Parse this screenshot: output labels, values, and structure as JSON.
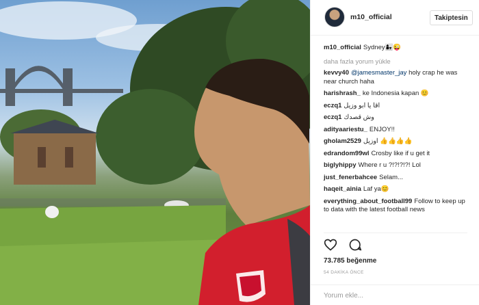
{
  "post": {
    "username": "m10_official",
    "follow_label": "Takiptesin"
  },
  "caption": {
    "user": "m10_official",
    "text": "Sydney👩‍👧😜"
  },
  "load_more_label": "daha fazla yorum yükle",
  "comments": [
    {
      "user": "kevvy40",
      "mention": "@jamesmaster_jay",
      "text": " holy crap he was near church haha"
    },
    {
      "user": "harishrash_",
      "mention": "",
      "text": "ke Indonesia kapan 😊"
    },
    {
      "user": "eczq1",
      "mention": "",
      "text": "اقا یا ابو وزیل"
    },
    {
      "user": "eczq1",
      "mention": "",
      "text": "وش قصدك"
    },
    {
      "user": "adityaariestu_",
      "mention": "",
      "text": "ENJOY!!"
    },
    {
      "user": "gholam2529",
      "mention": "",
      "text": "اوزیل 👍👍👍👍"
    },
    {
      "user": "edrandom99wl",
      "mention": "",
      "text": "Crosby like if u get it"
    },
    {
      "user": "biglyhippy",
      "mention": "",
      "text": "Where r u ?!?!?!?! Lol"
    },
    {
      "user": "just_fenerbahcee",
      "mention": "",
      "text": "Selam..."
    },
    {
      "user": "haqeit_ainia",
      "mention": "",
      "text": "Laf ya😊"
    },
    {
      "user": "everything_about_football99",
      "mention": "",
      "text": "Follow to keep up to data with the latest football news"
    }
  ],
  "actions": {
    "like_icon": "heart-icon",
    "comment_icon": "speech-bubble-icon"
  },
  "likes_label": "73.785 beğenme",
  "timestamp": "54 DAKİKA ÖNCE",
  "comment_input": {
    "placeholder": "Yorum ekle..."
  }
}
